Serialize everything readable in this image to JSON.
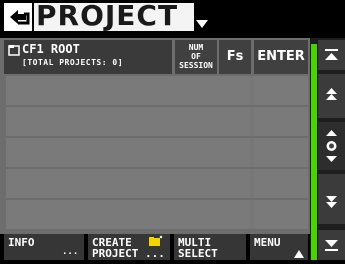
{
  "header": {
    "title": "PROJECT",
    "back_icon": "return-arrow-icon",
    "dropdown_icon": "triangle-down-icon"
  },
  "table": {
    "columns": {
      "name_line1": "CF1 ROOT",
      "name_line2": "[TOTAL PROJECTS: 0]",
      "num_of_session": [
        "NUM",
        "OF",
        "SESSION"
      ],
      "fs": "Fs",
      "enter": "ENTER"
    },
    "rows": 5
  },
  "footer": {
    "info": "INFO",
    "info_sub": "...",
    "create_line1": "CREATE",
    "create_line2": "PROJECT ...",
    "multi_line1": "MULTI",
    "multi_line2": "SELECT",
    "menu": "MENU"
  },
  "colors": {
    "scroll_accent": "#4bd300",
    "header_bg": "#404040",
    "row_bg": "#777777"
  }
}
